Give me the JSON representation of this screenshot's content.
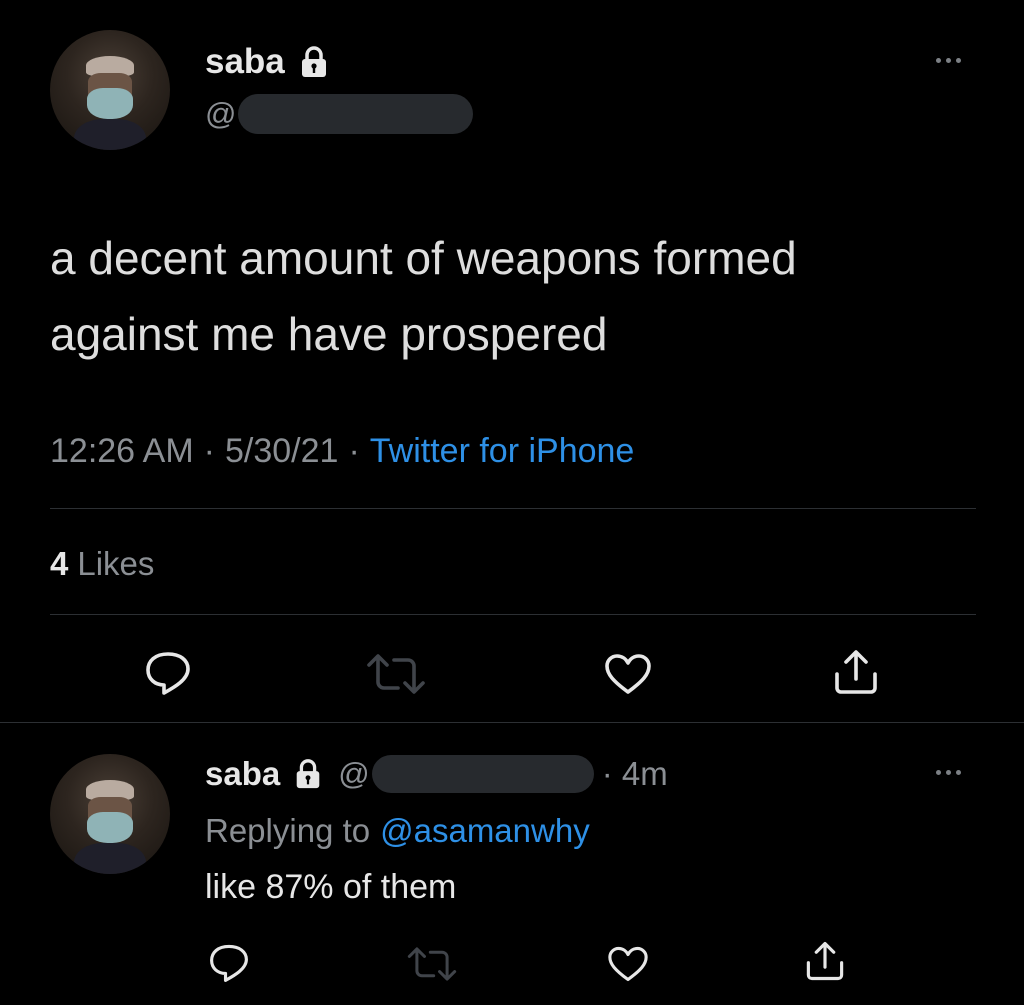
{
  "tweet": {
    "author_name": "saba",
    "handle_prefix": "@",
    "text_line1": "a decent amount of weapons formed",
    "text_line2": "against me have prospered",
    "time": "12:26 AM",
    "separator": "·",
    "date": "5/30/21",
    "source": "Twitter for iPhone",
    "likes_count": "4",
    "likes_label": "Likes"
  },
  "reply": {
    "author_name": "saba",
    "handle_prefix": "@",
    "age": "· 4m",
    "replying_prefix": "Replying to",
    "replying_to": "@asamanwhy",
    "text": "like 87% of them"
  },
  "icons": [
    "lock-icon",
    "more-icon",
    "reply-icon",
    "retweet-icon",
    "like-icon",
    "share-icon"
  ],
  "colors": {
    "background": "#000000",
    "link": "#2e90e6",
    "muted": "#8b8f94"
  }
}
